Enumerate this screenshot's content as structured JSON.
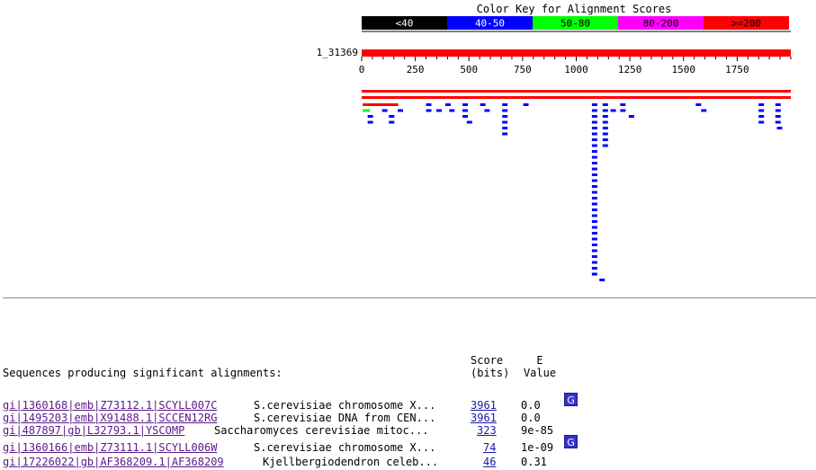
{
  "color_key": {
    "title": "Color Key for Alignment Scores",
    "bins": [
      {
        "label": "<40",
        "color": "#000000",
        "text_color": "#ffffff"
      },
      {
        "label": "40-50",
        "color": "#0000ff",
        "text_color": "#ffffff"
      },
      {
        "label": "50-80",
        "color": "#00ff00",
        "text_color": "#000000"
      },
      {
        "label": "80-200",
        "color": "#ff00ff",
        "text_color": "#000000"
      },
      {
        "label": ">=200",
        "color": "#ff0000",
        "text_color": "#000000"
      }
    ]
  },
  "query": {
    "label": "1_31369",
    "length": 2000,
    "ticks": [
      0,
      250,
      500,
      750,
      1000,
      1250,
      1500,
      1750
    ],
    "color": "#ff0000"
  },
  "hits": {
    "full_length": [
      {
        "start": 0,
        "end": 2000,
        "color": "#ff0000"
      },
      {
        "start": 0,
        "end": 2000,
        "color": "#ff0000"
      }
    ],
    "segments": [
      {
        "start": 5,
        "end": 170,
        "row": 0,
        "color": "#ff0000"
      },
      {
        "start": 5,
        "end": 38,
        "row": 1,
        "color": "#00ff00"
      },
      {
        "column": [
          {
            "start": 28,
            "end": 53,
            "rows": [
              2,
              3
            ]
          }
        ]
      },
      {
        "column": [
          {
            "start": 95,
            "end": 120,
            "rows": [
              1
            ]
          }
        ]
      },
      {
        "column": [
          {
            "start": 127,
            "end": 152,
            "rows": [
              2,
              3
            ]
          }
        ]
      },
      {
        "column": [
          {
            "start": 168,
            "end": 193,
            "rows": [
              1
            ]
          }
        ]
      },
      {
        "column": [
          {
            "start": 300,
            "end": 325,
            "rows": [
              0,
              1
            ]
          }
        ]
      },
      {
        "column": [
          {
            "start": 348,
            "end": 373,
            "rows": [
              1
            ]
          }
        ]
      },
      {
        "column": [
          {
            "start": 390,
            "end": 415,
            "rows": [
              0
            ]
          }
        ]
      },
      {
        "column": [
          {
            "start": 408,
            "end": 433,
            "rows": [
              1
            ]
          }
        ]
      },
      {
        "column": [
          {
            "start": 470,
            "end": 495,
            "rows": [
              0,
              1,
              2
            ]
          }
        ]
      },
      {
        "column": [
          {
            "start": 490,
            "end": 515,
            "rows": [
              3
            ]
          }
        ]
      },
      {
        "column": [
          {
            "start": 552,
            "end": 577,
            "rows": [
              0
            ]
          }
        ]
      },
      {
        "column": [
          {
            "start": 572,
            "end": 597,
            "rows": [
              1
            ]
          }
        ]
      },
      {
        "column": [
          {
            "start": 655,
            "end": 680,
            "rows": [
              0,
              1,
              2,
              3,
              4,
              5
            ]
          }
        ]
      },
      {
        "column": [
          {
            "start": 753,
            "end": 778,
            "rows": [
              0
            ]
          }
        ]
      },
      {
        "column": [
          {
            "start": 1073,
            "end": 1098,
            "rows": "0-29"
          }
        ]
      },
      {
        "column": [
          {
            "start": 1108,
            "end": 1133,
            "rows": [
              30
            ]
          }
        ]
      },
      {
        "column": [
          {
            "start": 1123,
            "end": 1148,
            "rows": [
              0,
              1,
              2,
              3,
              4,
              5,
              6,
              7
            ]
          }
        ]
      },
      {
        "column": [
          {
            "start": 1160,
            "end": 1185,
            "rows": [
              1
            ]
          }
        ]
      },
      {
        "column": [
          {
            "start": 1205,
            "end": 1230,
            "rows": [
              0,
              1
            ]
          }
        ]
      },
      {
        "column": [
          {
            "start": 1245,
            "end": 1270,
            "rows": [
              2
            ]
          }
        ]
      },
      {
        "column": [
          {
            "start": 1557,
            "end": 1582,
            "rows": [
              0
            ]
          }
        ]
      },
      {
        "column": [
          {
            "start": 1582,
            "end": 1607,
            "rows": [
              1
            ]
          }
        ]
      },
      {
        "column": [
          {
            "start": 1850,
            "end": 1875,
            "rows": [
              0,
              1,
              2,
              3
            ]
          }
        ]
      },
      {
        "column": [
          {
            "start": 1928,
            "end": 1953,
            "rows": [
              0,
              1,
              2,
              3
            ]
          }
        ]
      },
      {
        "column": [
          {
            "start": 1935,
            "end": 1960,
            "rows": [
              4
            ]
          }
        ]
      }
    ],
    "blue_color": "#0000ff"
  },
  "results": {
    "header_left": "Sequences producing significant alignments:",
    "header_score": "Score\n(bits)",
    "header_evalue": "E\nValue",
    "rows": [
      {
        "accession": "gi|1360168|emb|Z73112.1|SCYLL007C",
        "description": "S.cerevisiae chromosome X...",
        "score": "3961",
        "evalue": "0.0",
        "gene_link": "G"
      },
      {
        "accession": "gi|1495203|emb|X91488.1|SCCEN12RG",
        "description": "S.cerevisiae DNA from CEN...",
        "score": "3961",
        "evalue": "0.0",
        "gene_link": ""
      },
      {
        "accession": "gi|487897|gb|L32793.1|YSCOMP",
        "description": "Saccharomyces cerevisiae mitoc...",
        "score": "323",
        "evalue": "9e-85",
        "gene_link": ""
      },
      {
        "accession": "gi|1360166|emb|Z73111.1|SCYLL006W",
        "description": "S.cerevisiae chromosome X...",
        "score": "74",
        "evalue": "1e-09",
        "gene_link": "G"
      },
      {
        "accession": "gi|17226022|gb|AF368209.1|AF368209",
        "description": "Kjellbergiodendron celeb...",
        "score": "46",
        "evalue": "0.31",
        "gene_link": ""
      }
    ]
  }
}
